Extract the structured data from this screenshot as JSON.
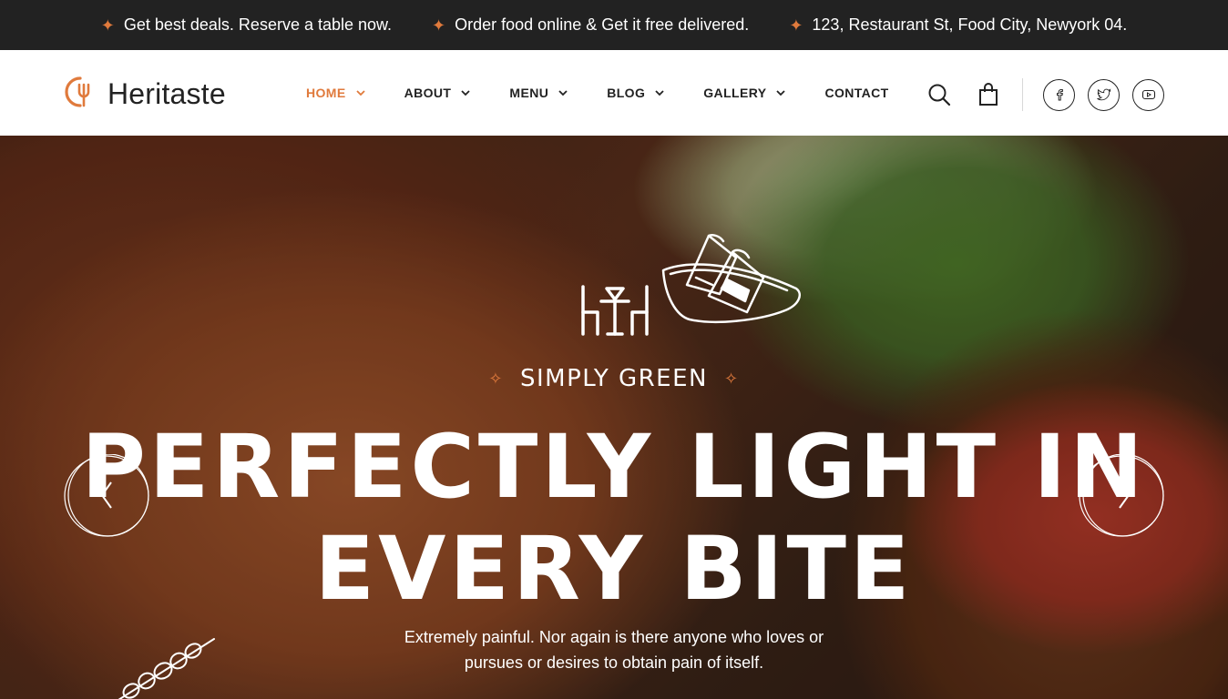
{
  "topbar": {
    "items": [
      "Get best deals. Reserve a table now.",
      "Order food online & Get it free delivered.",
      "123, Restaurant St, Food City, Newyork 04."
    ]
  },
  "brand": {
    "name": "Heritaste",
    "accent_color": "#e07a3c",
    "dark_color": "#222222"
  },
  "nav": {
    "items": [
      {
        "label": "HOME",
        "has_dropdown": true,
        "active": true
      },
      {
        "label": "ABOUT",
        "has_dropdown": true,
        "active": false
      },
      {
        "label": "MENU",
        "has_dropdown": true,
        "active": false
      },
      {
        "label": "BLOG",
        "has_dropdown": true,
        "active": false
      },
      {
        "label": "GALLERY",
        "has_dropdown": true,
        "active": false
      },
      {
        "label": "CONTACT",
        "has_dropdown": false,
        "active": false
      }
    ]
  },
  "header_icons": {
    "search": "search-icon",
    "cart": "shopping-bag-icon",
    "social": [
      "facebook-icon",
      "twitter-icon",
      "youtube-icon"
    ]
  },
  "hero": {
    "tagline": "SIMPLY GREEN",
    "headline_line1": "PERFECTLY LIGHT IN",
    "headline_line2": "EVERY BITE",
    "subtext_line1": "Extremely painful. Nor again is there anyone who loves or",
    "subtext_line2": "pursues or desires to obtain pain of itself.",
    "prev_icon": "chevron-left-icon",
    "next_icon": "chevron-right-icon"
  }
}
